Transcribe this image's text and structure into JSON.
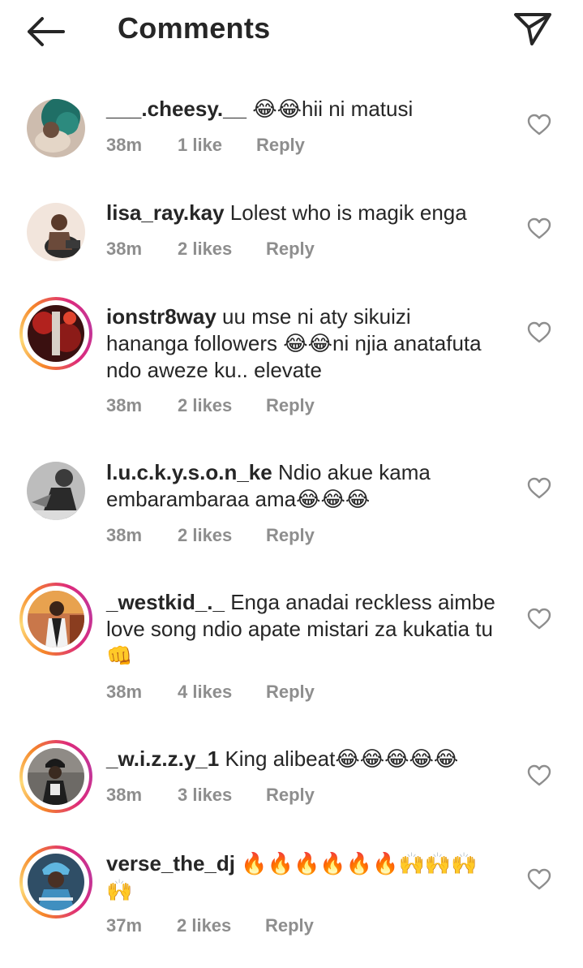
{
  "header": {
    "title": "Comments"
  },
  "comments": [
    {
      "username": "___.cheesy.__",
      "text": " 😂😂hii ni matusi",
      "time": "38m",
      "likes": "1 like",
      "reply": "Reply"
    },
    {
      "username": "lisa_ray.kay",
      "text": " Lolest who is magik enga",
      "time": "38m",
      "likes": "2 likes",
      "reply": "Reply"
    },
    {
      "username": "ionstr8way",
      "text": " uu mse ni aty sikuizi hananga followers 😂😂ni njia anatafuta ndo aweze ku.. elevate",
      "time": "38m",
      "likes": "2 likes",
      "reply": "Reply"
    },
    {
      "username": "l.u.c.k.y.s.o.n_ke",
      "text": " Ndio akue kama embarambaraa ama😂😂😂",
      "time": "38m",
      "likes": "2 likes",
      "reply": "Reply"
    },
    {
      "username": "_westkid_._",
      "text": " Enga anadai reckless aimbe love song ndio apate mistari za kukatia tu👊",
      "time": "38m",
      "likes": "4 likes",
      "reply": "Reply"
    },
    {
      "username": "_w.i.z.z.y_1",
      "text": " King alibeat😂😂😂😂😂",
      "time": "38m",
      "likes": "3 likes",
      "reply": "Reply"
    },
    {
      "username": "verse_the_dj",
      "text": " 🔥🔥🔥🔥🔥🔥🙌🙌🙌🙌",
      "time": "37m",
      "likes": "2 likes",
      "reply": "Reply"
    }
  ]
}
